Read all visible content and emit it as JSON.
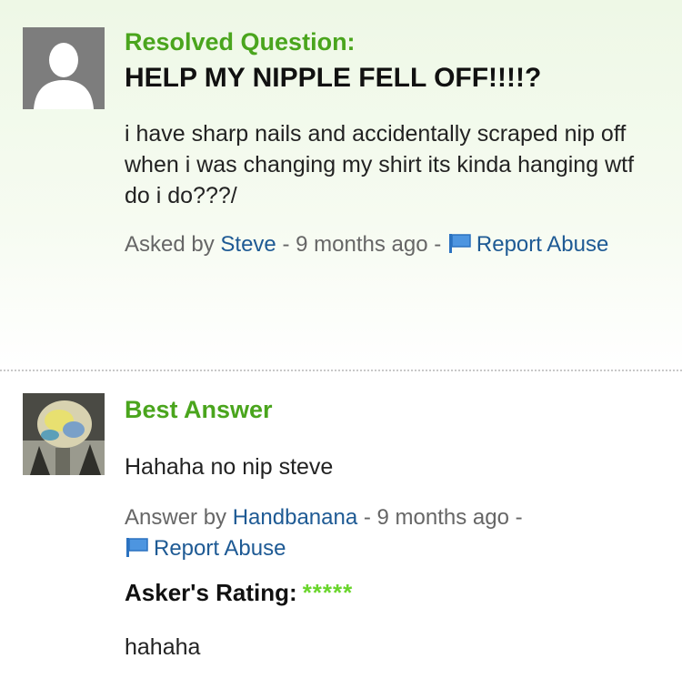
{
  "question": {
    "status_label": "Resolved Question:",
    "title": "HELP MY NIPPLE FELL OFF!!!!?",
    "body": "i have sharp nails and accidentally scraped nip off when i was changing my shirt its kinda hanging wtf do i do???/",
    "asked_prefix": "Asked by",
    "asker": "Steve",
    "sep1": "-",
    "time": "9 months ago",
    "sep2": "-",
    "report": "Report Abuse"
  },
  "answer": {
    "label": "Best Answer",
    "body": "Hahaha no nip steve",
    "answer_prefix": "Answer by",
    "answerer": "Handbanana",
    "sep1": "-",
    "time": "9 months ago",
    "sep2": "-",
    "report": "Report Abuse",
    "rating_label": "Asker's Rating:",
    "rating_stars": "*****",
    "rating_value": 5,
    "asker_comment": "hahaha"
  },
  "colors": {
    "green_label": "#4aa51d",
    "link": "#1e5a94",
    "star": "#6ad52c"
  },
  "icons": [
    "default-avatar-icon",
    "flag-icon",
    "user-photo-avatar"
  ]
}
